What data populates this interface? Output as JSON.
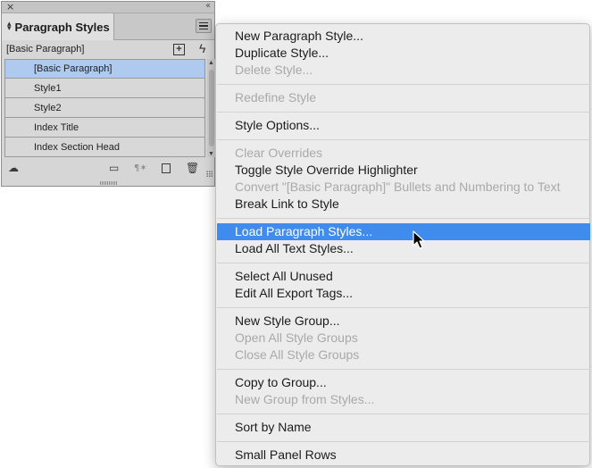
{
  "panel": {
    "close_glyph": "×",
    "collapse_glyph": "‹‹",
    "tab_label": "Paragraph Styles",
    "current_style": "[Basic Paragraph]",
    "styles": [
      {
        "name": "[Basic Paragraph]",
        "selected": true
      },
      {
        "name": "Style1",
        "selected": false
      },
      {
        "name": "Style2",
        "selected": false
      },
      {
        "name": "Index Title",
        "selected": false
      },
      {
        "name": "Index Section Head",
        "selected": false
      }
    ],
    "icons": {
      "cloud": "cloud-library-icon",
      "folder": "new-style-group-icon",
      "clear": "clear-overrides-icon",
      "new": "create-new-style-icon",
      "trash": "delete-style-icon",
      "lightning": "quick-apply-icon",
      "new_from_selection": "new-style-from-selection-icon"
    }
  },
  "menu": {
    "highlight_color": "#3f8bee",
    "items": [
      {
        "label": "New Paragraph Style...",
        "disabled": false
      },
      {
        "label": "Duplicate Style...",
        "disabled": false
      },
      {
        "label": "Delete Style...",
        "disabled": true
      },
      {
        "label": "Redefine Style",
        "disabled": true
      },
      {
        "label": "Style Options...",
        "disabled": false
      },
      {
        "label": "Clear Overrides",
        "disabled": true
      },
      {
        "label": "Toggle Style Override Highlighter",
        "disabled": false
      },
      {
        "label": "Convert \"[Basic Paragraph]\" Bullets and Numbering to Text",
        "disabled": true
      },
      {
        "label": "Break Link to Style",
        "disabled": false
      },
      {
        "label": "Load Paragraph Styles...",
        "disabled": false,
        "highlighted": true
      },
      {
        "label": "Load All Text Styles...",
        "disabled": false
      },
      {
        "label": "Select All Unused",
        "disabled": false
      },
      {
        "label": "Edit All Export Tags...",
        "disabled": false
      },
      {
        "label": "New Style Group...",
        "disabled": false
      },
      {
        "label": "Open All Style Groups",
        "disabled": true
      },
      {
        "label": "Close All Style Groups",
        "disabled": true
      },
      {
        "label": "Copy to Group...",
        "disabled": false
      },
      {
        "label": "New Group from Styles...",
        "disabled": true
      },
      {
        "label": "Sort by Name",
        "disabled": false
      },
      {
        "label": "Small Panel Rows",
        "disabled": false
      }
    ]
  }
}
